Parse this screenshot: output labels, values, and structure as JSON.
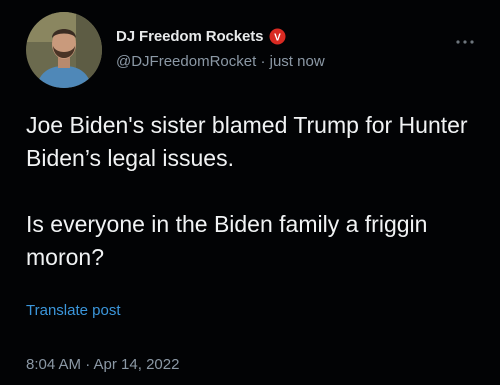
{
  "author": {
    "display_name": "DJ Freedom Rockets",
    "handle": "@DJFreedomRocket",
    "separator": "·",
    "relative_time": "just now",
    "badge_letter": "V"
  },
  "post": {
    "paragraphs": [
      "Joe Biden's sister blamed Trump for Hunter Biden’s legal issues.",
      "Is everyone in the Biden family a friggin moron?"
    ],
    "translate_label": "Translate post",
    "timestamp": "8:04 AM · Apr 14, 2022"
  },
  "icons": {
    "more": "more-horizontal-icon",
    "badge": "verified-badge-icon"
  },
  "colors": {
    "background": "#020305",
    "text": "#e7e9ea",
    "muted": "#8b98a5",
    "link": "#3b96db",
    "badge": "#d92a22"
  }
}
